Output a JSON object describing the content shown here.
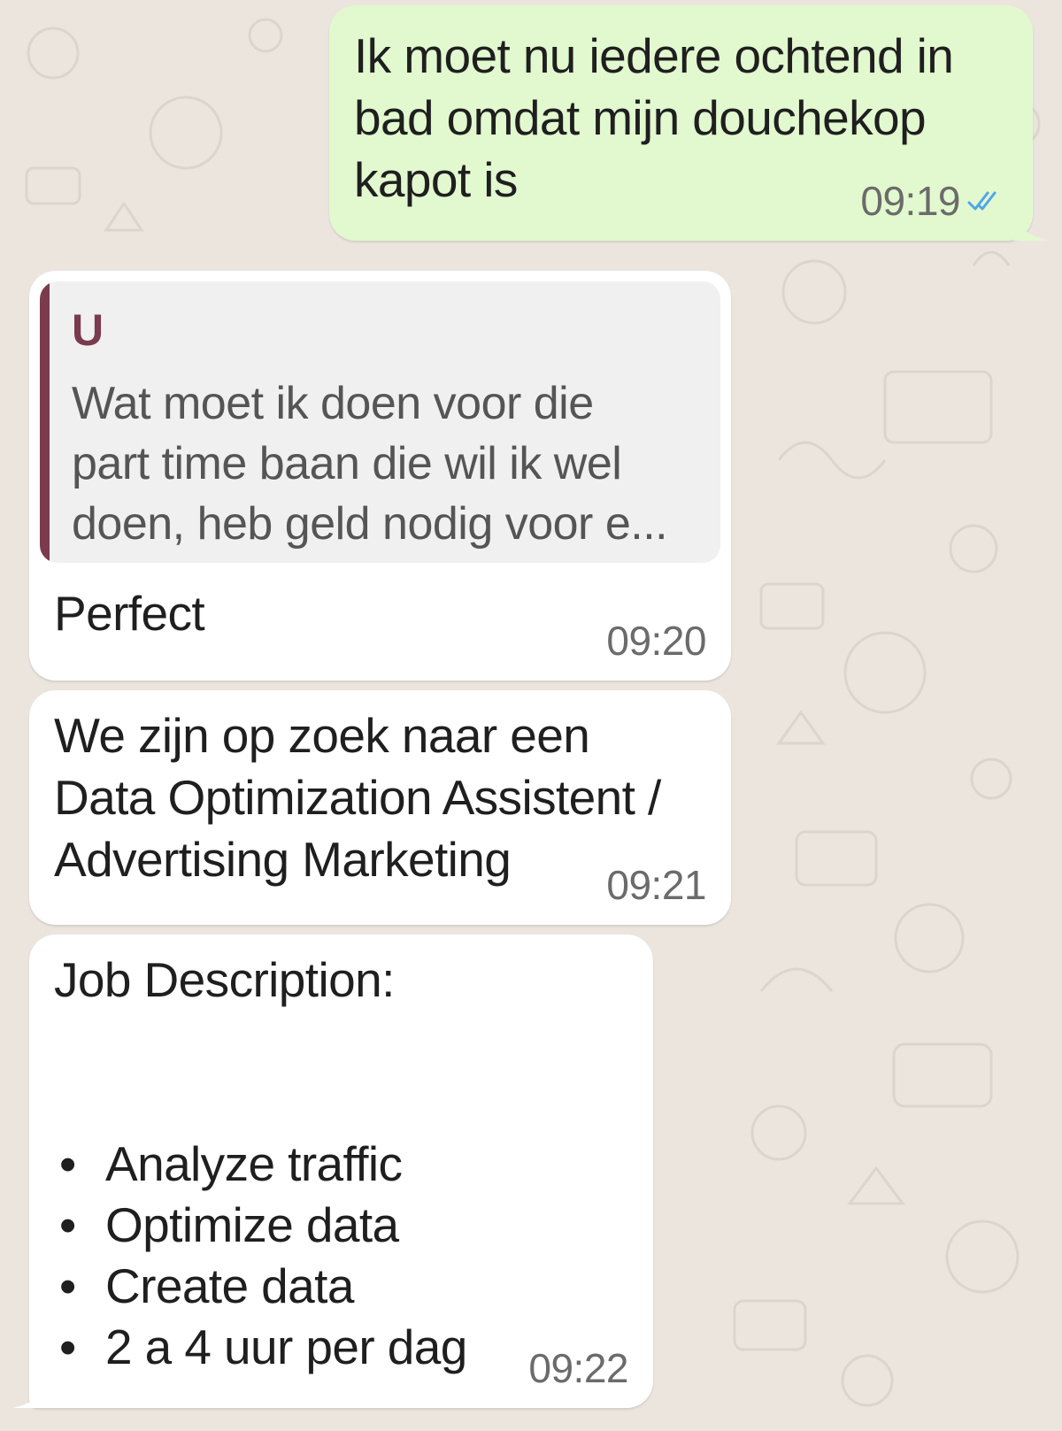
{
  "messages": [
    {
      "direction": "outgoing",
      "text": "Ik moet nu iedere ochtend in\nbad omdat mijn douchekop\nkapot is",
      "time": "09:19",
      "status_icon": "double-check-icon",
      "status_color": "#4fa6e8"
    },
    {
      "direction": "incoming",
      "quote": {
        "author": "U",
        "text": "Wat moet ik doen voor die\npart time baan die wil ik wel\ndoen, heb geld nodig voor e..."
      },
      "text": "Perfect",
      "time": "09:20"
    },
    {
      "direction": "incoming",
      "text": "We zijn op zoek naar een\nData Optimization Assistent /\nAdvertising Marketing",
      "time": "09:21"
    },
    {
      "direction": "incoming",
      "title": "Job Description:",
      "bullets": [
        "Analyze traffic",
        "Optimize data",
        "Create data",
        "2 a 4 uur per dag"
      ],
      "time": "09:22"
    }
  ],
  "colors": {
    "background": "#ebe5de",
    "outgoing_bubble": "#e2f8cf",
    "incoming_bubble": "#ffffff",
    "quote_accent": "#7a3b4d",
    "timestamp": "#6b6b6b"
  }
}
